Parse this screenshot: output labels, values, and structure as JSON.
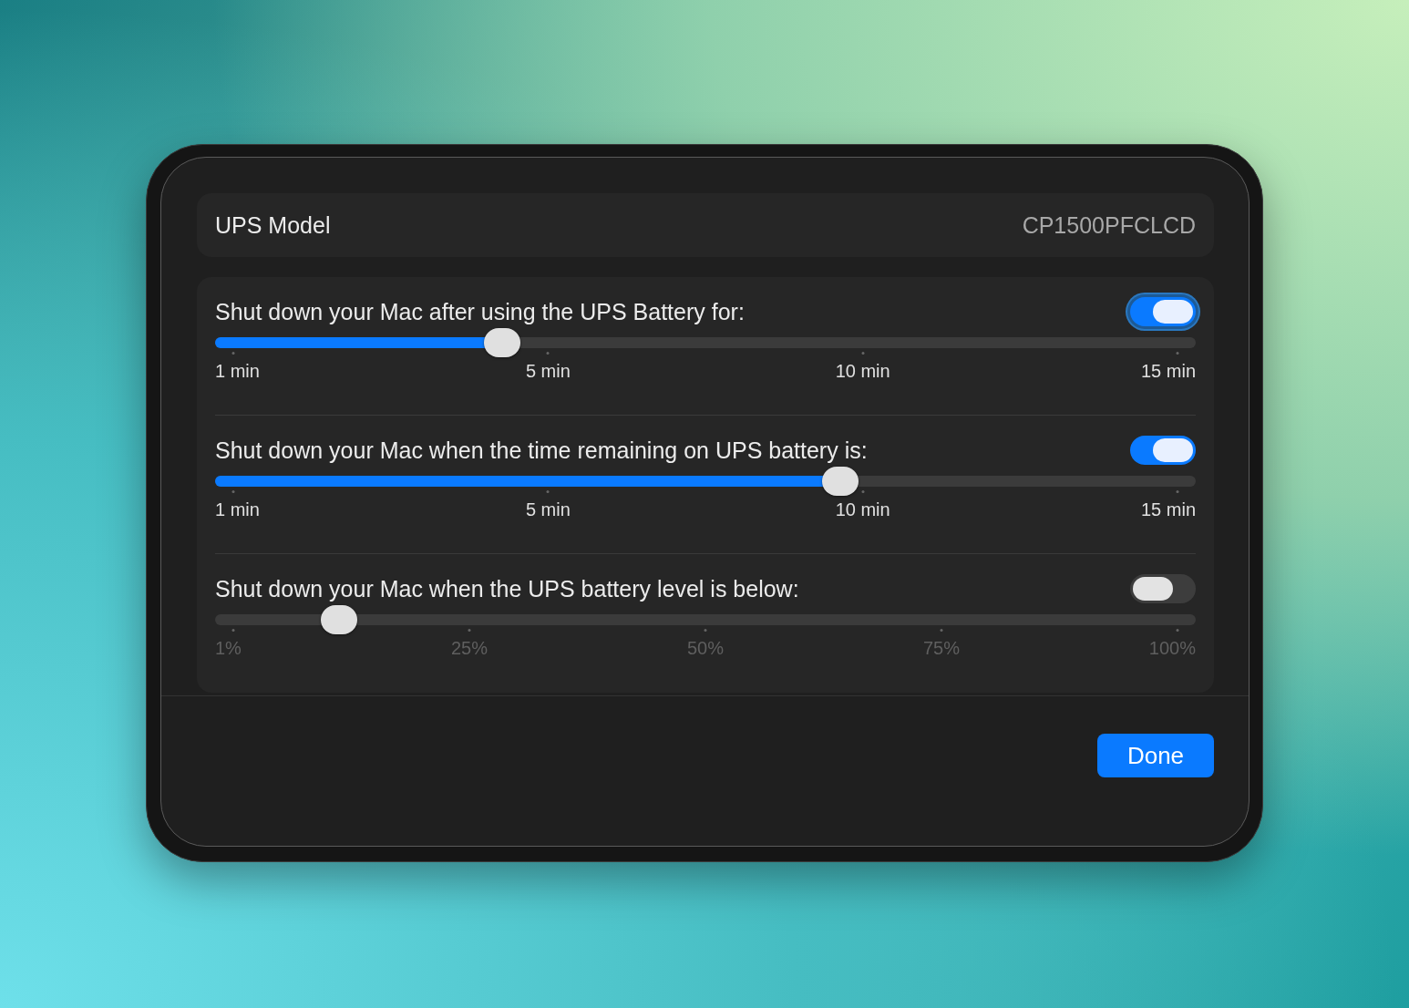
{
  "model": {
    "label": "UPS Model",
    "value": "CP1500PFCLCD"
  },
  "settings": [
    {
      "label": "Shut down your Mac after using the UPS Battery for:",
      "on": true,
      "focused": true,
      "level": 0.293,
      "ticks": [
        "1 min",
        "5 min",
        "10 min",
        "15 min"
      ]
    },
    {
      "label": "Shut down your Mac when the time remaining on UPS battery is:",
      "on": true,
      "focused": false,
      "level": 0.638,
      "ticks": [
        "1 min",
        "5 min",
        "10 min",
        "15 min"
      ]
    },
    {
      "label": "Shut down your Mac when the UPS battery level is below:",
      "on": false,
      "focused": false,
      "level": 0.126,
      "ticks": [
        "1%",
        "25%",
        "50%",
        "75%",
        "100%"
      ]
    }
  ],
  "buttons": [
    {
      "label": "Done"
    }
  ]
}
